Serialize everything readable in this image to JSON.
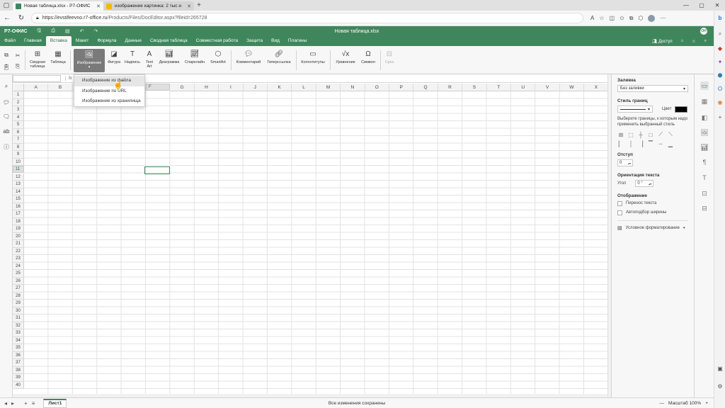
{
  "browser": {
    "tabs": [
      {
        "title": "Новая таблица.xlsx - Р7-ОФИС",
        "active": true,
        "fav_color": "#40865c"
      },
      {
        "title": "изображение картинка: 2 тыс и",
        "active": false,
        "fav_color": "#f5b800"
      }
    ],
    "url_host": "https://evstifeevno.r7-office.ru",
    "url_path": "/Products/Files/DocEditor.aspx?fileid=265728"
  },
  "app": {
    "logo": "Р7-ОФИС",
    "doc_title": "Новая таблица.xlsx",
    "user_initials": "ОН",
    "menu": [
      "Файл",
      "Главная",
      "Вставка",
      "Макет",
      "Формула",
      "Данные",
      "Сводная таблица",
      "Совместная работа",
      "Защита",
      "Вид",
      "Плагины"
    ],
    "active_menu": 2,
    "access_label": "Доступ"
  },
  "toolbar": {
    "pivot": "Сводная таблица",
    "table": "Таблица",
    "image": "Изображение",
    "shape": "Фигура",
    "textbox": "Надпись",
    "textart": "Text Art",
    "chart": "Диаграмма",
    "sparkline": "Спарклайн",
    "smartart": "SmartArt",
    "comment": "Комментарий",
    "hyperlink": "Гиперссылка",
    "headers": "Колонтитулы",
    "equation": "Уравнение",
    "symbol": "Символ",
    "slicer": "Срез"
  },
  "formula": {
    "fx": "fx"
  },
  "dropdown": {
    "items": [
      "Изображение из файла",
      "Изображение по URL",
      "Изображение из хранилища"
    ]
  },
  "grid": {
    "columns": [
      "A",
      "B",
      "C",
      "D",
      "E",
      "F",
      "G",
      "H",
      "I",
      "J",
      "K",
      "L",
      "M",
      "N",
      "O",
      "P",
      "Q",
      "R",
      "S",
      "T",
      "U",
      "V",
      "W",
      "X"
    ],
    "selected_col": "F",
    "rows": 40,
    "selected_row": 11
  },
  "panel": {
    "fill_title": "Заливка",
    "fill_value": "Без заливки",
    "border_style_title": "Стиль границ",
    "color_label": "Цвет",
    "border_hint": "Выберите границы, к которым надо применить выбранный стиль",
    "indent_title": "Отступ",
    "indent_value": "0",
    "orientation_title": "Ориентация текста",
    "angle_label": "Угол",
    "angle_value": "0 °",
    "display_title": "Отображение",
    "wrap_text": "Перенос текста",
    "autofit": "Автоподбор ширины",
    "cond_format": "Условное форматирование"
  },
  "status": {
    "sheet": "Лист1",
    "saved": "Все изменения сохранены",
    "zoom": "Масштаб 100%"
  },
  "colors": {
    "brand": "#40865c"
  }
}
